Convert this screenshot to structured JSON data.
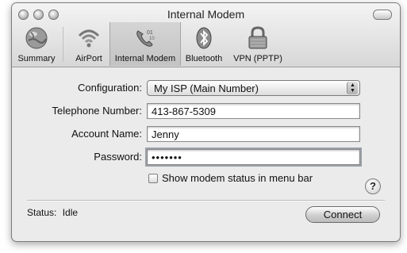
{
  "window": {
    "title": "Internal Modem"
  },
  "toolbar": {
    "items": [
      {
        "label": "Summary",
        "icon": "globe-icon"
      },
      {
        "label": "AirPort",
        "icon": "airport-icon"
      },
      {
        "label": "Internal Modem",
        "icon": "phone-icon",
        "selected": true
      },
      {
        "label": "Bluetooth",
        "icon": "bluetooth-icon"
      },
      {
        "label": "VPN (PPTP)",
        "icon": "lock-icon"
      }
    ]
  },
  "form": {
    "configuration_label": "Configuration:",
    "configuration_value": "My ISP (Main Number)",
    "telephone_label": "Telephone Number:",
    "telephone_value": "413-867-5309",
    "account_label": "Account Name:",
    "account_value": "Jenny",
    "password_label": "Password:",
    "password_value": "•••••••",
    "show_status_label": "Show modem status in menu bar",
    "show_status_checked": false
  },
  "help": {
    "glyph": "?"
  },
  "status": {
    "label": "Status:",
    "value": "Idle"
  },
  "buttons": {
    "connect_label": "Connect"
  }
}
